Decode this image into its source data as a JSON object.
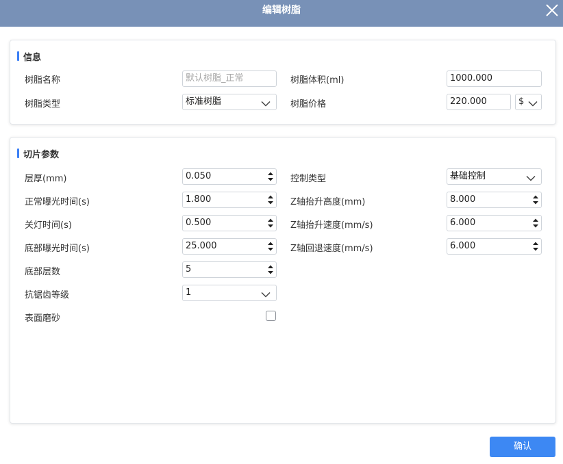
{
  "dialog": {
    "title": "编辑树脂",
    "close_icon": "close-icon",
    "confirm_label": "确认"
  },
  "info": {
    "title": "信息",
    "resin_name_label": "树脂名称",
    "resin_name_placeholder": "默认树脂_正常",
    "resin_volume_label": "树脂体积(ml)",
    "resin_volume": "1000.000",
    "resin_type_label": "树脂类型",
    "resin_type": "标准树脂",
    "resin_price_label": "树脂价格",
    "resin_price": "220.000",
    "currency": "$"
  },
  "slice": {
    "title": "切片参数",
    "layer_thickness_label": "层厚(mm)",
    "layer_thickness": "0.050",
    "normal_exposure_label": "正常曝光时间(s)",
    "normal_exposure": "1.800",
    "light_off_label": "关灯时间(s)",
    "light_off": "0.500",
    "bottom_exposure_label": "底部曝光时间(s)",
    "bottom_exposure": "25.000",
    "bottom_layers_label": "底部层数",
    "bottom_layers": "5",
    "antialias_label": "抗锯齿等级",
    "antialias": "1",
    "surface_frosting_label": "表面磨砂",
    "surface_frosting_checked": false,
    "control_type_label": "控制类型",
    "control_type": "基础控制",
    "z_lift_height_label": "Z轴抬升高度(mm)",
    "z_lift_height": "8.000",
    "z_lift_speed_label": "Z轴抬升速度(mm/s)",
    "z_lift_speed": "6.000",
    "z_retract_speed_label": "Z轴回退速度(mm/s)",
    "z_retract_speed": "6.000"
  },
  "colors": {
    "titlebar": "#7891b7",
    "accent": "#3b7ff5",
    "confirm_button": "#3d88f3"
  }
}
